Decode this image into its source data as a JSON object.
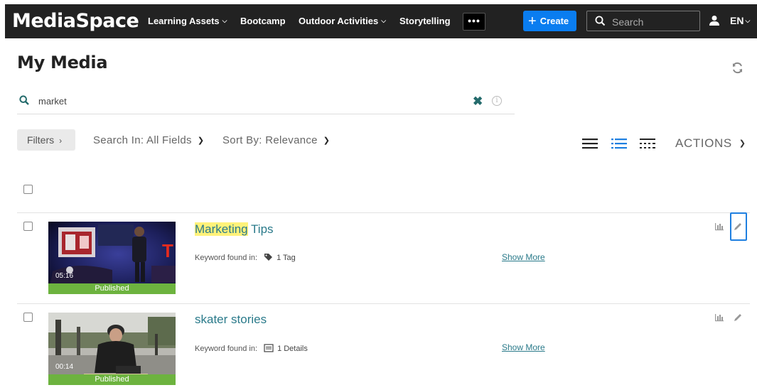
{
  "header": {
    "logo": "MediaSpace",
    "nav": [
      {
        "label": "Learning Assets",
        "dropdown": true
      },
      {
        "label": "Bootcamp",
        "dropdown": false
      },
      {
        "label": "Outdoor Activities",
        "dropdown": true
      },
      {
        "label": "Storytelling",
        "dropdown": false
      }
    ],
    "more_label": "•••",
    "create_label": "Create",
    "search_placeholder": "Search",
    "language": "EN"
  },
  "page": {
    "title": "My Media",
    "search_query": "market"
  },
  "toolbar": {
    "filters_label": "Filters",
    "search_in": "Search In: All Fields",
    "sort_by": "Sort By: Relevance",
    "actions_label": "ACTIONS"
  },
  "entries": [
    {
      "title_highlight": "Marketing",
      "title_rest": " Tips",
      "duration": "05:16",
      "status": "Published",
      "keyword_label": "Keyword found in:",
      "keyword_detail": "1 Tag",
      "keyword_icon": "tag-icon",
      "show_more": "Show More"
    },
    {
      "title_highlight": "",
      "title_rest": "skater stories",
      "duration": "00:14",
      "status": "Published",
      "keyword_label": "Keyword found in:",
      "keyword_detail": "1 Details",
      "keyword_icon": "details-icon",
      "show_more": "Show More"
    }
  ],
  "colors": {
    "topbar": "#222222",
    "create_button": "#0a7df0",
    "link": "#2a7a8a",
    "published": "#6db33f",
    "highlight": "#fff27a",
    "focus_outline": "#1e7fe0"
  }
}
